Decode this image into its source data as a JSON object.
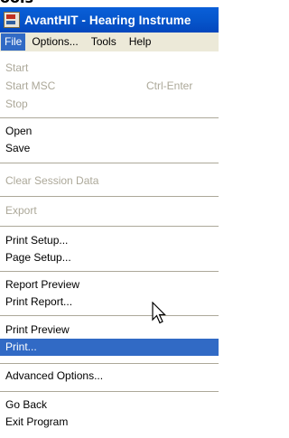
{
  "window": {
    "title": "AvantHIT - Hearing Instrume",
    "top_cut_text": "ools"
  },
  "menubar": {
    "items": [
      {
        "label": "File",
        "active": true
      },
      {
        "label": "Options..."
      },
      {
        "label": "Tools"
      },
      {
        "label": "Help"
      }
    ]
  },
  "file_menu": {
    "start": "Start",
    "start_msc": "Start MSC",
    "start_msc_shortcut": "Ctrl-Enter",
    "stop": "Stop",
    "open": "Open",
    "save": "Save",
    "clear_session_data": "Clear Session Data",
    "export": "Export",
    "print_setup": "Print Setup...",
    "page_setup": "Page Setup...",
    "report_preview": "Report Preview",
    "print_report": "Print Report...",
    "print_preview": "Print Preview",
    "print": "Print...",
    "advanced_options": "Advanced Options...",
    "go_back": "Go Back",
    "exit_program": "Exit Program"
  },
  "colors": {
    "highlight": "#316ac5",
    "disabled_text": "#aca899",
    "menubar_bg": "#ece9d8"
  }
}
